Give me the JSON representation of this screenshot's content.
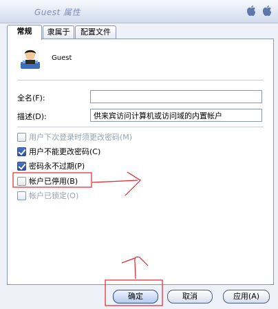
{
  "window": {
    "title": "Guest 属性"
  },
  "tabs": [
    {
      "label": "常规"
    },
    {
      "label": "隶属于"
    },
    {
      "label": "配置文件"
    }
  ],
  "user": {
    "name": "Guest"
  },
  "fields": {
    "fullname_label": "全名(F):",
    "fullname_value": "",
    "description_label": "描述(D):",
    "description_value": "供来宾访问计算机或访问域的内置帐户"
  },
  "checkboxes": [
    {
      "label": "用户下次登录时须更改密码(M)",
      "checked": false,
      "disabled": true
    },
    {
      "label": "用户不能更改密码(C)",
      "checked": true,
      "disabled": false
    },
    {
      "label": "密码永不过期(P)",
      "checked": true,
      "disabled": false
    },
    {
      "label": "帐户已停用(B)",
      "checked": false,
      "disabled": false
    },
    {
      "label": "帐户已锁定(O)",
      "checked": false,
      "disabled": true
    }
  ],
  "buttons": {
    "ok": "确定",
    "cancel": "取消",
    "apply": "应用(A)"
  },
  "colors": {
    "annotation": "#e8202a",
    "accent": "#2a4f9c"
  }
}
